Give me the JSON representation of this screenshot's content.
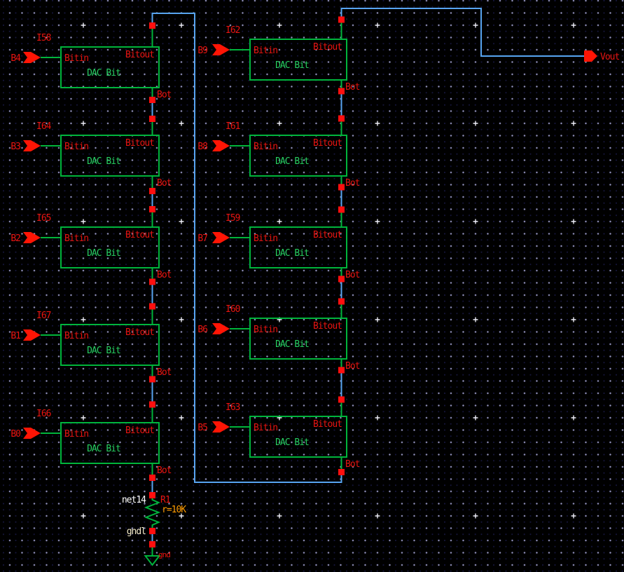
{
  "labels": {
    "bitin": "Bitin",
    "bitout": "Bitout",
    "bot": "Bot",
    "cell_name": "DAC Bit"
  },
  "left_column": [
    {
      "instance": "I58",
      "input": "B4"
    },
    {
      "instance": "I64",
      "input": "B3"
    },
    {
      "instance": "I65",
      "input": "B2"
    },
    {
      "instance": "I67",
      "input": "B1"
    },
    {
      "instance": "I66",
      "input": "B0"
    }
  ],
  "right_column": [
    {
      "instance": "I62",
      "input": "B9"
    },
    {
      "instance": "I61",
      "input": "B8"
    },
    {
      "instance": "I59",
      "input": "B7"
    },
    {
      "instance": "I60",
      "input": "B6"
    },
    {
      "instance": "I63",
      "input": "B5"
    }
  ],
  "output_pin": "Vout",
  "resistor": {
    "instance": "R1",
    "value": "r=10K"
  },
  "nets": {
    "resistor_top": "net14",
    "resistor_bottom": "gndl"
  },
  "ground": {
    "label": "gnd"
  },
  "colors": {
    "background": "#000000",
    "device_green": "#00b43c",
    "wire_blue": "#57a4f0",
    "pin_red": "#ff1505",
    "label_red": "#e81410",
    "value_orange": "#ff9c00",
    "net_white": "#ffffff",
    "net_cream": "#f5eccb"
  }
}
